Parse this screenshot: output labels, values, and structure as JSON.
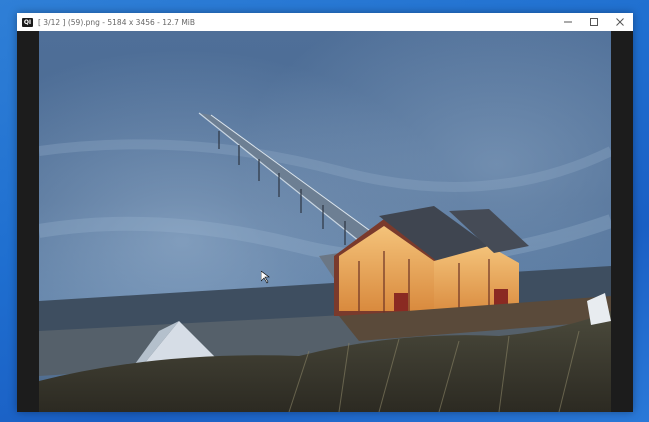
{
  "window": {
    "app_icon": "QI",
    "title": "[ 3/12 ]  (59).png  -  5184 x 3456  -  12.7 MiB",
    "controls": [
      "minimize-icon",
      "maximize-icon",
      "close-icon"
    ]
  },
  "colors": {
    "desktop": "#1f6fd0",
    "titlebar": "#ffffff",
    "viewer_bg": "#1c1c1c",
    "sea": "#4d6f96"
  },
  "photo": {
    "subject": "pier-with-lit-pavilion"
  }
}
